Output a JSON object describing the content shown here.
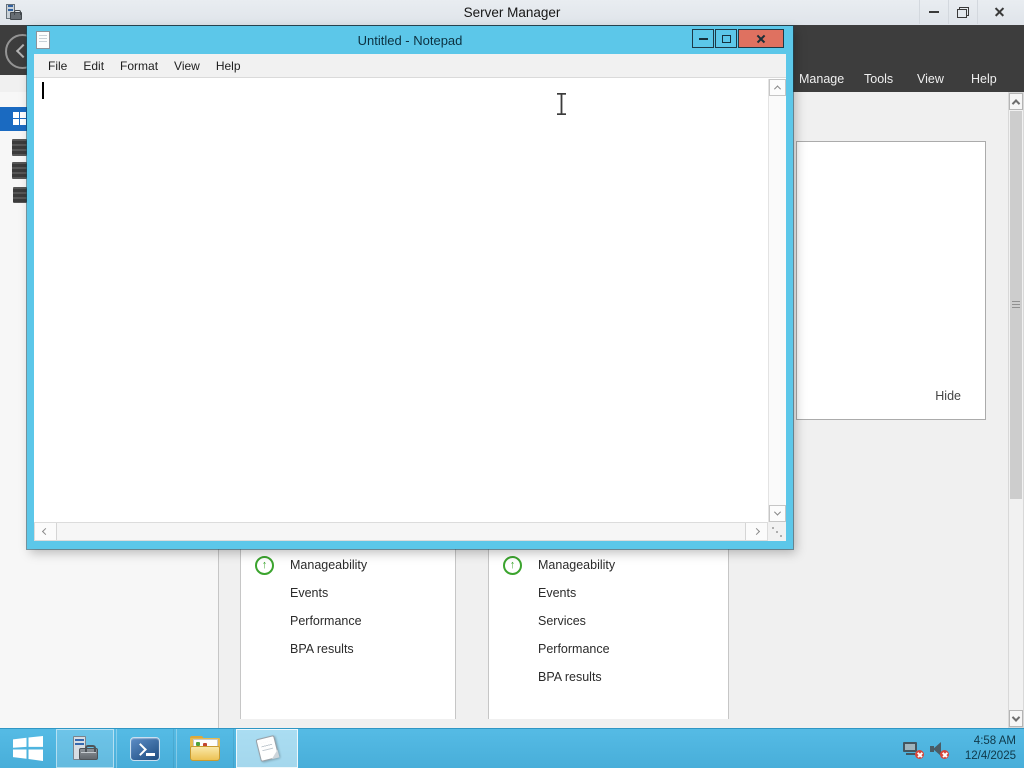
{
  "server_manager": {
    "title": "Server Manager",
    "menu": [
      "Manage",
      "Tools",
      "View",
      "Help"
    ],
    "welcome_panel": {
      "hide_label": "Hide"
    },
    "tiles": [
      {
        "status": "up",
        "rows": [
          "Manageability",
          "Events",
          "Performance",
          "BPA results"
        ]
      },
      {
        "status": "up",
        "rows": [
          "Manageability",
          "Events",
          "Services",
          "Performance",
          "BPA results"
        ]
      }
    ]
  },
  "notepad": {
    "title": "Untitled - Notepad",
    "menu": [
      "File",
      "Edit",
      "Format",
      "View",
      "Help"
    ],
    "text": ""
  },
  "taskbar": {
    "clock": {
      "time": "4:58 AM",
      "date": "12/4/2025"
    }
  },
  "icons": {
    "status_arrow": "↑"
  },
  "colors": {
    "window_chrome": "#5CC7E9",
    "taskbar": "#4FB5E0",
    "close_button": "#DF7160",
    "command_bar": "#3D3D3D",
    "selected_nav": "#1A6AC1",
    "status_green": "#3BA42E",
    "content_bg": "#F0F0F0"
  }
}
